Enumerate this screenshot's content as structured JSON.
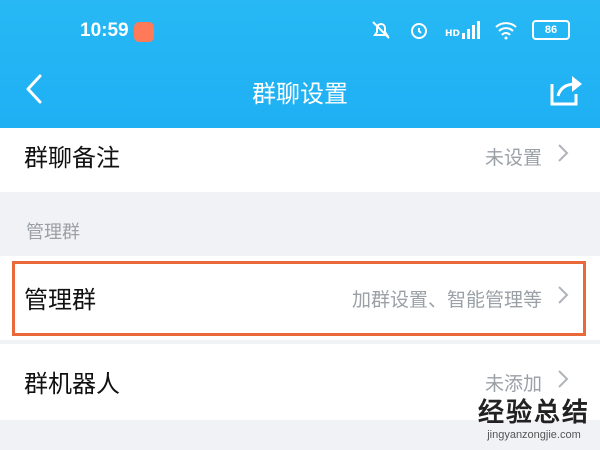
{
  "status_bar": {
    "time": "10:59",
    "network": "HD",
    "battery": "86"
  },
  "header": {
    "title": "群聊设置"
  },
  "rows": {
    "remark": {
      "label": "群聊备注",
      "value": "未设置"
    },
    "manage": {
      "label": "管理群",
      "value": "加群设置、智能管理等"
    },
    "robot": {
      "label": "群机器人",
      "value": "未添加"
    }
  },
  "section": {
    "manage_header": "管理群"
  },
  "watermark": {
    "title": "经验总结",
    "url": "jingyanzongjie.com"
  },
  "colors": {
    "header_bg": "#1eb0f3",
    "highlight": "#e9693b",
    "secondary_text": "#9aa0a6"
  }
}
